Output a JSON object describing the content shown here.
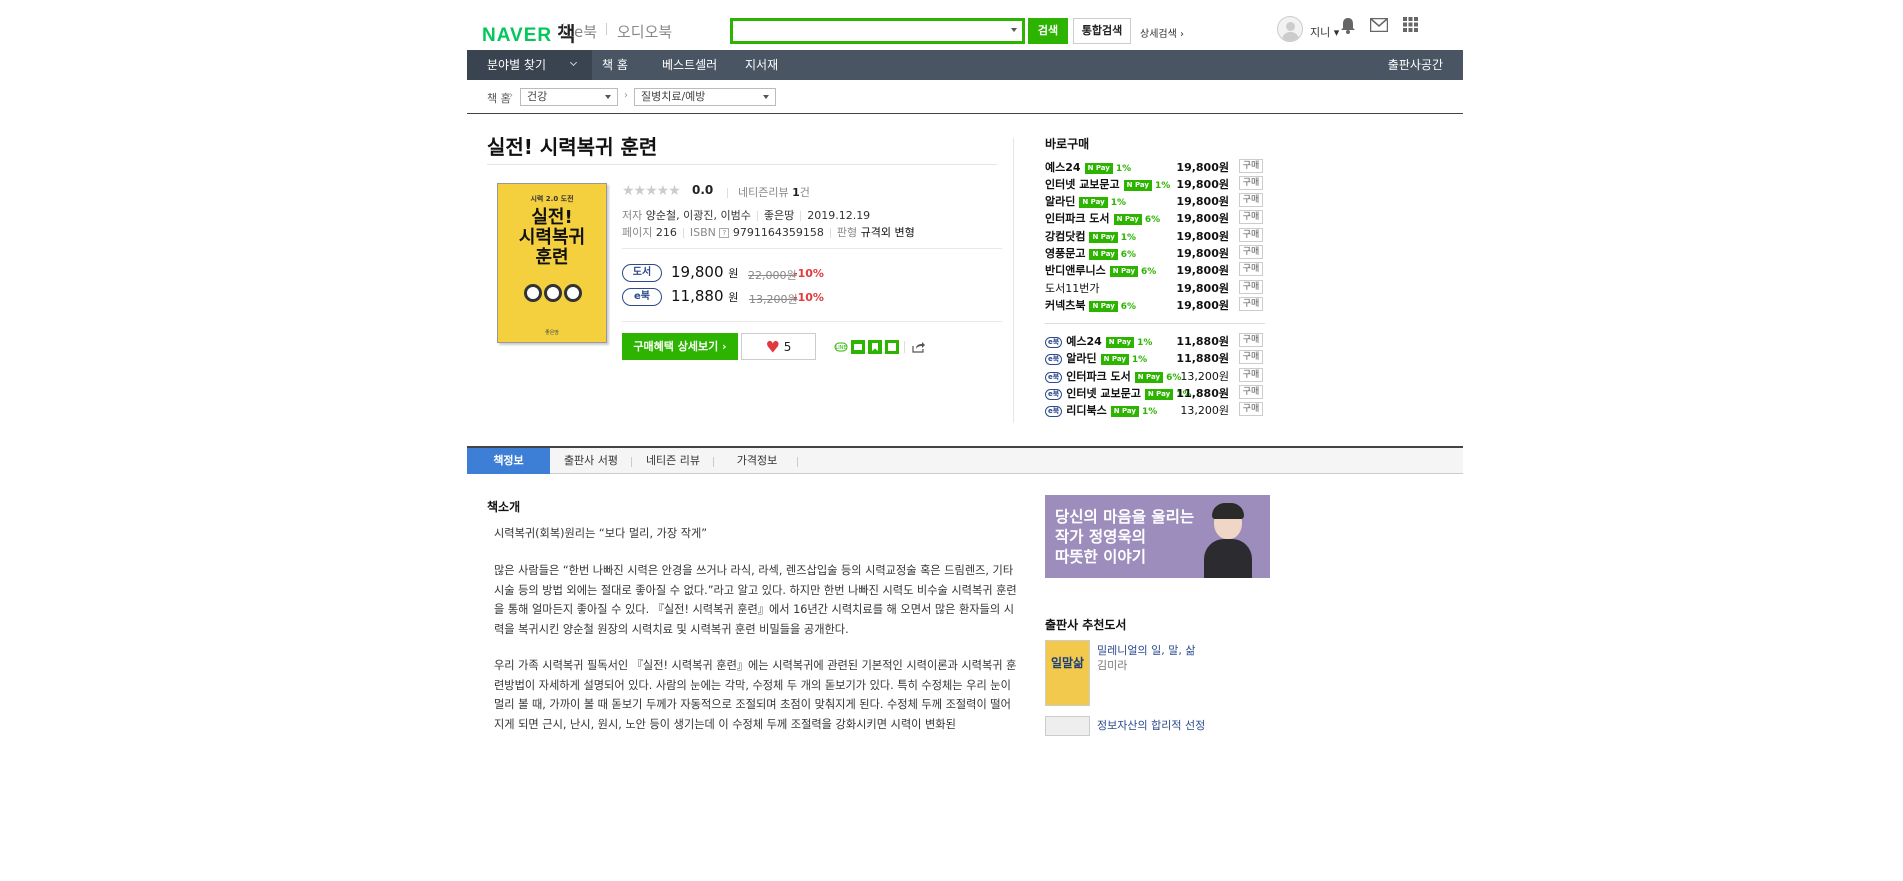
{
  "header": {
    "logo_naver": "NAVER",
    "logo_book": "책",
    "link_ebook": "e북",
    "link_audiobook": "오디오북",
    "search_placeholder": "",
    "search_button": "검색",
    "integrated_search_button": "통합검색",
    "advanced_search": "상세검색",
    "username": "지니"
  },
  "nav": {
    "category_label": "분야별 찾기",
    "items": [
      "책 홈",
      "베스트셀러",
      "지서재"
    ],
    "publisher_space": "출판사공간"
  },
  "breadcrumb": {
    "home": "책 홈",
    "level1": "건강",
    "level2": "질병치료/예방"
  },
  "book": {
    "title": "실전! 시력복귀 훈련",
    "rating": "0.0",
    "review_label": "네티즌리뷰",
    "review_count": "1",
    "review_unit": "건",
    "author_label": "저자",
    "authors": "양순철, 이광진, 이범수",
    "publisher": "좋은땅",
    "pub_date": "2019.12.19",
    "pages_label": "페이지",
    "pages": "216",
    "isbn_label": "ISBN",
    "isbn": "9791164359158",
    "format_label": "판형",
    "format": "규격외 변형",
    "cover_top": "시력 2.0 도전",
    "cover_title_1": "실전!",
    "cover_title_2": "시력복귀",
    "cover_title_3": "훈련",
    "cover_publisher": "좋은땅"
  },
  "prices": [
    {
      "type": "도서",
      "price": "19,800",
      "won": "원",
      "original": "22,000원",
      "discount": "-10%"
    },
    {
      "type": "e북",
      "price": "11,880",
      "won": "원",
      "original": "13,200원",
      "discount": "-10%"
    }
  ],
  "actions": {
    "benefit_button": "구매혜택 상세보기",
    "like_count": "5"
  },
  "buy": {
    "title": "바로구매",
    "buy_label": "구매",
    "npay_label": "N Pay",
    "print": [
      {
        "store": "예스24",
        "pct": "1%",
        "price": "19,800원"
      },
      {
        "store": "인터넷 교보문고",
        "pct": "1%",
        "price": "19,800원"
      },
      {
        "store": "알라딘",
        "pct": "1%",
        "price": "19,800원"
      },
      {
        "store": "인터파크 도서",
        "pct": "6%",
        "price": "19,800원"
      },
      {
        "store": "강컴닷컴",
        "pct": "1%",
        "price": "19,800원"
      },
      {
        "store": "영풍문고",
        "pct": "6%",
        "price": "19,800원"
      },
      {
        "store": "반디앤루니스",
        "pct": "6%",
        "price": "19,800원"
      },
      {
        "store": "도서11번가",
        "pct": "",
        "price": "19,800원"
      },
      {
        "store": "커넥츠북",
        "pct": "6%",
        "price": "19,800원"
      }
    ],
    "ebook_tag": "e북",
    "ebook": [
      {
        "store": "예스24",
        "pct": "1%",
        "price": "11,880원",
        "bold": true
      },
      {
        "store": "알라딘",
        "pct": "1%",
        "price": "11,880원",
        "bold": true
      },
      {
        "store": "인터파크 도서",
        "pct": "6%",
        "price": "13,200원",
        "bold": false
      },
      {
        "store": "인터넷 교보문고",
        "pct": "1%",
        "price": "11,880원",
        "bold": true
      },
      {
        "store": "리디북스",
        "pct": "1%",
        "price": "13,200원",
        "bold": false
      }
    ]
  },
  "tabs": [
    "책정보",
    "출판사 서평",
    "네티즌 리뷰",
    "가격정보"
  ],
  "intro": {
    "title": "책소개",
    "p1": "시력복귀(회복)원리는 “보다 멀리, 가장 작게”",
    "p2": "많은 사람들은 “한번 나빠진 시력은 안경을 쓰거나 라식, 라섹, 렌즈삽입술 등의 시력교정술 혹은 드림렌즈, 기타 시술 등의 방법 외에는 절대로 좋아질 수 없다.”라고 알고 있다. 하지만 한번 나빠진 시력도 비수술 시력복귀 훈련을 통해 얼마든지 좋아질 수 있다. 『실전! 시력복귀 훈련』에서 16년간 시력치료를 해 오면서 많은 환자들의 시력을 복귀시킨 양순철 원장의 시력치료 및 시력복귀 훈련 비밀들을 공개한다.",
    "p3": "우리 가족 시력복귀 필독서인 『실전! 시력복귀 훈련』에는 시력복귀에 관련된 기본적인 시력이론과 시력복귀 훈련방법이 자세하게 설명되어 있다. 사람의 눈에는 각막, 수정체 두 개의 돋보기가 있다. 특히 수정체는 우리 눈이 멀리 볼 때, 가까이 볼 때 돋보기 두께가 자동적으로 조절되며 초점이 맞춰지게 된다. 수정체 두께 조절력이 떨어지게 되면 근시, 난시, 원시, 노안 등이 생기는데 이 수정체 두께 조절력을 강화시키면 시력이 변화된"
  },
  "banner": {
    "line1": "당신의 마음을 울리는",
    "line2": "작가 정영욱의",
    "line3": "따뜻한 이야기"
  },
  "recommend": {
    "title": "출판사 추천도서",
    "books": [
      {
        "name": "밀레니얼의 일, 말, 삶",
        "author": "김미라",
        "cover": "일말삶"
      },
      {
        "name": "정보자산의 합리적 선정",
        "author": ""
      }
    ]
  },
  "colors": {
    "brand_green": "#2db400",
    "nav_bg": "#4a5563",
    "tab_active": "#3d7fd6",
    "discount_red": "#e0393e"
  }
}
